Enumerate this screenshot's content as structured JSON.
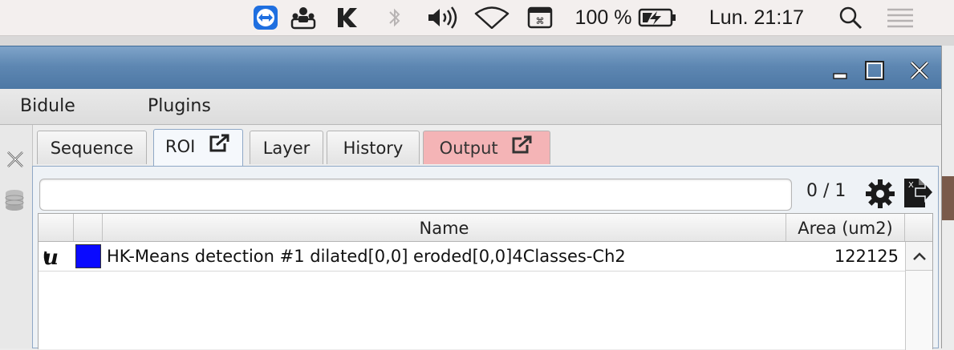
{
  "menubar": {
    "icons": [
      "teamviewer-icon",
      "people-icon",
      "kaspersky-icon",
      "bluetooth-icon",
      "volume-icon",
      "wifi-icon",
      "keyboard-icon"
    ],
    "battery_percent": "100 %",
    "battery_icon": "battery-charging-icon",
    "clock": "Lun. 21:17",
    "search_icon": "spotlight-icon",
    "list_icon": "notification-center-icon"
  },
  "window": {
    "controls": [
      "minimize-icon",
      "maximize-icon",
      "close-icon"
    ],
    "menu": [
      "Bidule",
      "Plugins"
    ]
  },
  "tabs": [
    {
      "label": "Sequence"
    },
    {
      "label": "ROI"
    },
    {
      "label": "Layer"
    },
    {
      "label": "History"
    },
    {
      "label": "Output"
    }
  ],
  "roi_panel": {
    "filter_value": "",
    "counter": "0 / 1",
    "columns": {
      "name": "Name",
      "area": "Area (um2)"
    },
    "rows": [
      {
        "name": "HK-Means detection #1 dilated[0,0] eroded[0,0]4Classes-Ch2",
        "area": "122125",
        "color": "#0a0aff"
      }
    ]
  },
  "colors": {
    "titlebar": "#5e87b2",
    "output_tab": "#f4b4b6",
    "roi_swatch": "#0a0aff"
  }
}
